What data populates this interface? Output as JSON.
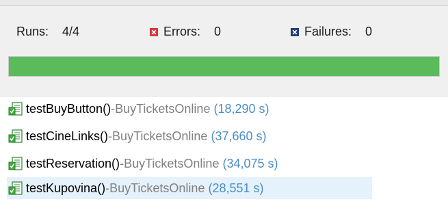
{
  "summary": {
    "runs_label": "Runs:",
    "runs_value": "4/4",
    "errors_label": "Errors:",
    "errors_value": "0",
    "failures_label": "Failures:",
    "failures_value": "0",
    "progress_fraction": 1.0,
    "colors": {
      "progress": "#5bbb5b",
      "error_icon": "#d9363e",
      "failure_icon": "#1f3f7a"
    }
  },
  "tests": [
    {
      "name": "testBuyButton()",
      "separator": " - ",
      "class": "BuyTicketsOnline",
      "time": "(18,290 s)",
      "icon": "test-passed-icon",
      "selected": false
    },
    {
      "name": "testCineLinks()",
      "separator": " - ",
      "class": "BuyTicketsOnline",
      "time": "(37,660 s)",
      "icon": "test-passed-icon",
      "selected": false
    },
    {
      "name": "testReservation()",
      "separator": " - ",
      "class": "BuyTicketsOnline",
      "time": "(34,075 s)",
      "icon": "test-passed-icon",
      "selected": false
    },
    {
      "name": "testKupovina()",
      "separator": " - ",
      "class": "BuyTicketsOnline",
      "time": "(28,551 s)",
      "icon": "test-passed-icon",
      "selected": true
    }
  ]
}
